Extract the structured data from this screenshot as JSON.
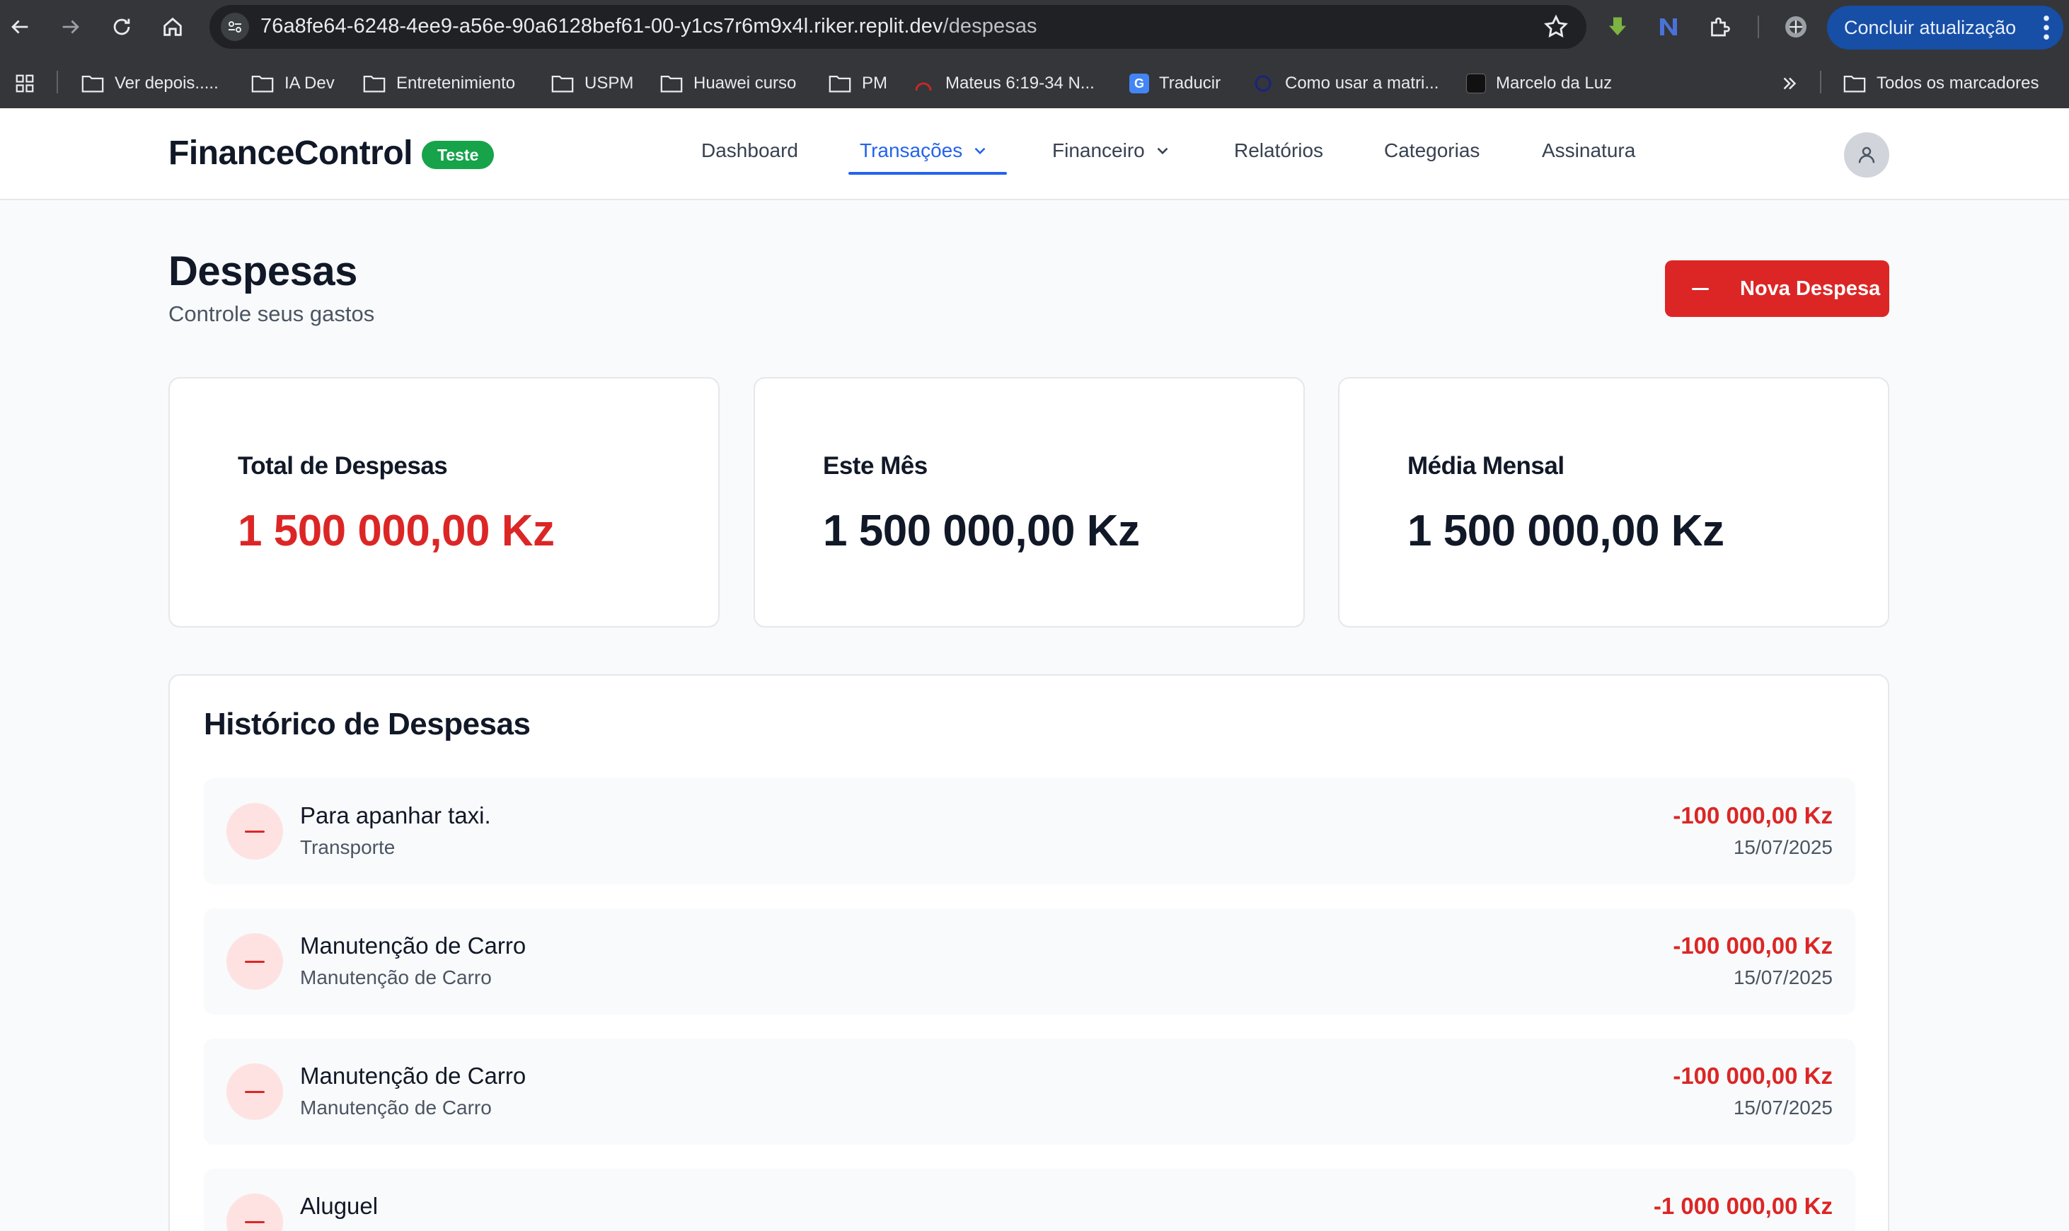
{
  "browser": {
    "url_host": "76a8fe64-6248-4ee9-a56e-90a6128bef61-00-y1cs7r6m9x4l.riker.replit.dev",
    "url_path": "/despesas",
    "update_button": "Concluir atualização",
    "bookmarks": [
      {
        "label": "Ver depois.....",
        "icon": "folder-icon"
      },
      {
        "label": "IA Dev",
        "icon": "folder-icon"
      },
      {
        "label": "Entretenimiento",
        "icon": "folder-icon"
      },
      {
        "label": "USPM",
        "icon": "folder-icon"
      },
      {
        "label": "Huawei curso",
        "icon": "folder-icon"
      },
      {
        "label": "PM",
        "icon": "folder-icon"
      },
      {
        "label": "Mateus 6:19-34 N...",
        "icon": "site-favicon"
      },
      {
        "label": "Traducir",
        "icon": "translate-favicon"
      },
      {
        "label": "Como usar a matri...",
        "icon": "site-favicon"
      },
      {
        "label": "Marcelo da Luz",
        "icon": "site-favicon"
      }
    ],
    "all_bookmarks": "Todos os marcadores"
  },
  "app": {
    "brand": "FinanceControl",
    "env_badge": "Teste",
    "nav": [
      "Dashboard",
      "Transações",
      "Financeiro",
      "Relatórios",
      "Categorias",
      "Assinatura"
    ],
    "active_nav": "Transações",
    "accent_color": "#2563eb",
    "danger_color": "#dc2626",
    "badge_color": "#16a34a"
  },
  "page": {
    "title": "Despesas",
    "subtitle": "Controle seus gastos",
    "new_button": "Nova Despesa"
  },
  "stats": [
    {
      "label": "Total de Despesas",
      "value": "1 500 000,00 Kz"
    },
    {
      "label": "Este Mês",
      "value": "1 500 000,00 Kz"
    },
    {
      "label": "Média Mensal",
      "value": "1 500 000,00 Kz"
    }
  ],
  "history": {
    "title": "Histórico de Despesas",
    "items": [
      {
        "title": "Para apanhar taxi.",
        "category": "Transporte",
        "amount": "-100 000,00 Kz",
        "date": "15/07/2025"
      },
      {
        "title": "Manutenção de Carro",
        "category": "Manutenção de Carro",
        "amount": "-100 000,00 Kz",
        "date": "15/07/2025"
      },
      {
        "title": "Manutenção de Carro",
        "category": "Manutenção de Carro",
        "amount": "-100 000,00 Kz",
        "date": "15/07/2025"
      },
      {
        "title": "Aluguel",
        "category": "",
        "amount": "-1 000 000,00 Kz",
        "date": ""
      }
    ]
  }
}
